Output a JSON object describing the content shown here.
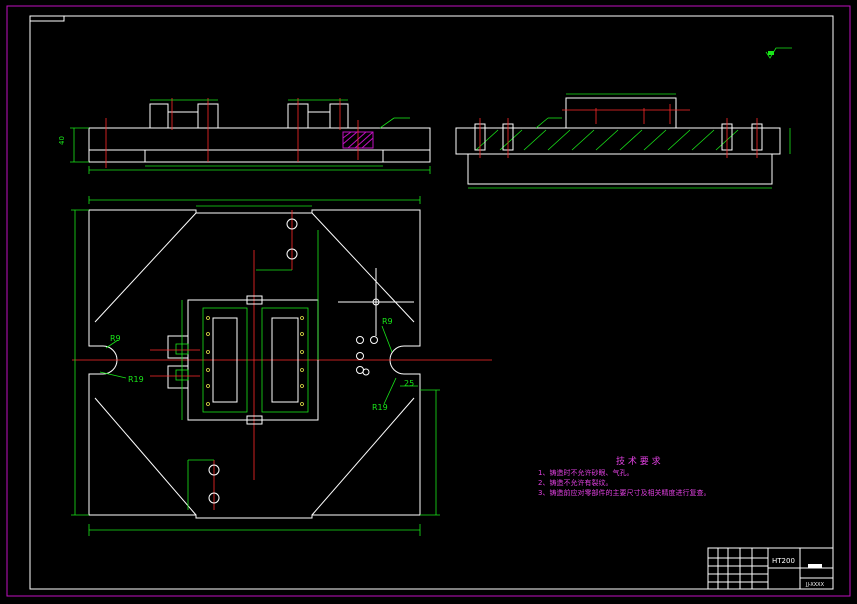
{
  "labels": {
    "radius_left_top": "R9",
    "radius_left_bottom": "R19",
    "radius_right_top": "R9",
    "radius_right_bottom": "R19",
    "dim_25": "25",
    "dim_40": "40"
  },
  "notes": {
    "title": "技 术 要 求",
    "items": [
      "1、铸造时不允许砂眼、气孔。",
      "2、铸造不允许有裂纹。",
      "3、铸造前应对零部件的主要尺寸及相关精度进行复查。"
    ]
  },
  "title_block": {
    "material": "HT200",
    "drawing_no": "JJ-XXXX"
  },
  "colors": {
    "background": "#000000",
    "outline": "#ffffff",
    "dimension": "#19e619",
    "centerline": "#ff2a2a",
    "frame": "#c010c0",
    "notes": "#e040e0"
  }
}
